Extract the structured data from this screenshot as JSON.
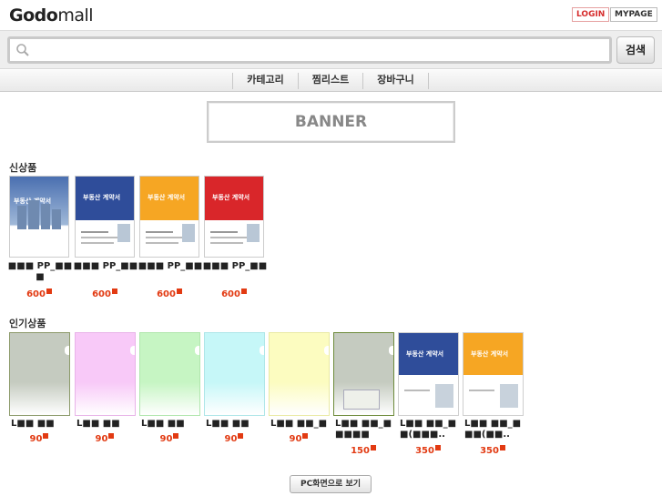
{
  "header": {
    "logo_bold": "Godo",
    "logo_light": "mall",
    "login": "LOGIN",
    "mypage": "MYPAGE"
  },
  "search": {
    "placeholder": "",
    "value": "",
    "button": "검색"
  },
  "nav": {
    "items": [
      "카테고리",
      "찜리스트",
      "장바구니"
    ]
  },
  "banner": {
    "label": "BANNER"
  },
  "new_products": {
    "title": "신상품",
    "items": [
      {
        "name": "■■■ PP_■■■",
        "price": "600",
        "cover_title": "부동산 계약서",
        "cover": "tower",
        "cover_color": "#3a5c9c"
      },
      {
        "name": "■■■ PP_■■",
        "price": "600",
        "cover_title": "부동산 계약서",
        "cover": "blue",
        "cover_color": "#2f4d9a"
      },
      {
        "name": "■■■ PP_■■",
        "price": "600",
        "cover_title": "부동산 계약서",
        "cover": "orange",
        "cover_color": "#f6a623"
      },
      {
        "name": "■■■ PP_■■",
        "price": "600",
        "cover_title": "부동산 계약서",
        "cover": "red",
        "cover_color": "#d9262a"
      }
    ]
  },
  "popular_products": {
    "title": "인기상품",
    "items": [
      {
        "name": "L■■ ■■",
        "price": "90",
        "color": "#c5cbc0",
        "frame": "#8c9a6a"
      },
      {
        "name": "L■■ ■■",
        "price": "90",
        "color": "#f8c9f8",
        "frame": "#e8b3e8"
      },
      {
        "name": "L■■ ■■",
        "price": "90",
        "color": "#c6f5c3",
        "frame": "#b0e6ad"
      },
      {
        "name": "L■■ ■■",
        "price": "90",
        "color": "#c6f7f8",
        "frame": "#aee6e8"
      },
      {
        "name": "L■■ ■■_■",
        "price": "90",
        "color": "#fcfcc0",
        "frame": "#eaeaa4"
      },
      {
        "name": "L■■ ■■_■■■■■",
        "price": "150",
        "color": "#c5cbc0",
        "frame": "#6d8a3a"
      },
      {
        "name": "L■■ ■■_■■(■■■..",
        "price": "350",
        "cover_title": "부동산 계약서",
        "color": "#2f4d9a",
        "frame": "#cfcfcf"
      },
      {
        "name": "L■■ ■■_■■■(■■..",
        "price": "350",
        "cover_title": "부동산 계약서",
        "color": "#f6a623",
        "frame": "#cfcfcf"
      }
    ]
  },
  "footer": {
    "pc_view": "PC화면으로 보기"
  },
  "colors": {
    "accent": "#e23a12",
    "login": "#d62b2b"
  }
}
